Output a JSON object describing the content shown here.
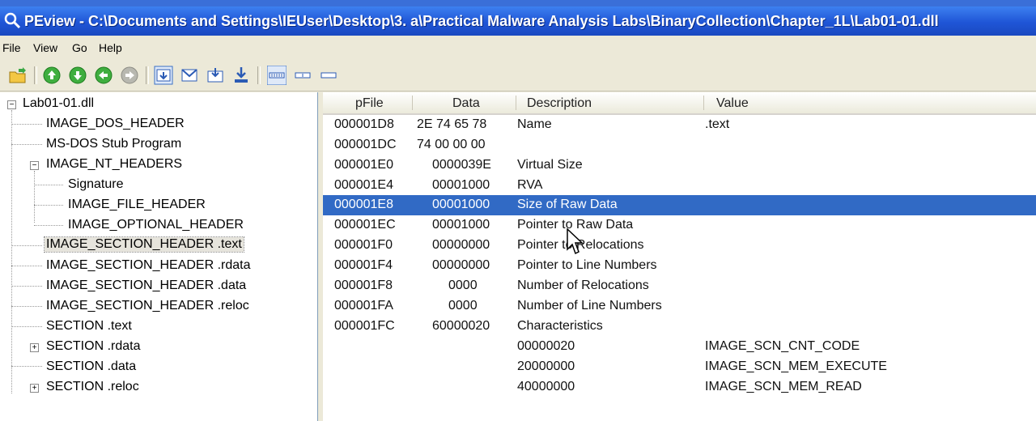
{
  "window": {
    "title": "PEview - C:\\Documents and Settings\\IEUser\\Desktop\\3. a\\Practical Malware Analysis Labs\\BinaryCollection\\Chapter_1L\\Lab01-01.dll"
  },
  "menu": [
    "File",
    "View",
    "Go",
    "Help"
  ],
  "toolbar": {
    "icons": [
      "open-folder-icon",
      "nav-up-icon",
      "nav-down-icon",
      "nav-back-icon",
      "nav-forward-icon",
      "view-hex-icon",
      "view-mail-icon",
      "view-save-icon",
      "view-download-icon",
      "view-wide-icon",
      "view-narrow-icon",
      "view-narrow2-icon"
    ]
  },
  "tree": {
    "root": "Lab01-01.dll",
    "items": [
      "IMAGE_DOS_HEADER",
      "MS-DOS Stub Program",
      "IMAGE_NT_HEADERS",
      "Signature",
      "IMAGE_FILE_HEADER",
      "IMAGE_OPTIONAL_HEADER",
      "IMAGE_SECTION_HEADER .text",
      "IMAGE_SECTION_HEADER .rdata",
      "IMAGE_SECTION_HEADER .data",
      "IMAGE_SECTION_HEADER .reloc",
      "SECTION .text",
      "SECTION .rdata",
      "SECTION .data",
      "SECTION .reloc"
    ],
    "selected": "IMAGE_SECTION_HEADER .text"
  },
  "table": {
    "columns": [
      "pFile",
      "Data",
      "Description",
      "Value"
    ],
    "rows": [
      {
        "pfile": "000001D8",
        "data": "2E  74  65  78",
        "desc": "Name",
        "value": ".text"
      },
      {
        "pfile": "000001DC",
        "data": "74  00  00  00",
        "desc": "",
        "value": ""
      },
      {
        "pfile": "000001E0",
        "data": "0000039E",
        "desc": "Virtual Size",
        "value": ""
      },
      {
        "pfile": "000001E4",
        "data": "00001000",
        "desc": "RVA",
        "value": ""
      },
      {
        "pfile": "000001E8",
        "data": "00001000",
        "desc": "Size of Raw Data",
        "value": ""
      },
      {
        "pfile": "000001EC",
        "data": "00001000",
        "desc": "Pointer to Raw Data",
        "value": ""
      },
      {
        "pfile": "000001F0",
        "data": "00000000",
        "desc": "Pointer to Relocations",
        "value": ""
      },
      {
        "pfile": "000001F4",
        "data": "00000000",
        "desc": "Pointer to Line Numbers",
        "value": ""
      },
      {
        "pfile": "000001F8",
        "data": "0000",
        "desc": "Number of Relocations",
        "value": ""
      },
      {
        "pfile": "000001FA",
        "data": "0000",
        "desc": "Number of Line Numbers",
        "value": ""
      },
      {
        "pfile": "000001FC",
        "data": "60000020",
        "desc": "Characteristics",
        "value": ""
      },
      {
        "pfile": "",
        "data": "",
        "desc": "00000020",
        "value": "IMAGE_SCN_CNT_CODE"
      },
      {
        "pfile": "",
        "data": "",
        "desc": "20000000",
        "value": "IMAGE_SCN_MEM_EXECUTE"
      },
      {
        "pfile": "",
        "data": "",
        "desc": "40000000",
        "value": "IMAGE_SCN_MEM_READ"
      }
    ],
    "selected_row": 4
  },
  "colors": {
    "title_bar": "#1f55d6",
    "selection": "#316ac5"
  }
}
